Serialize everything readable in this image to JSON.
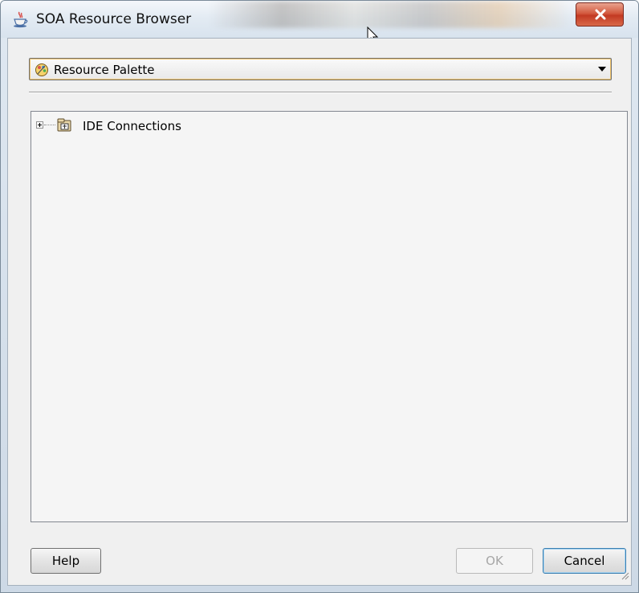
{
  "window": {
    "title": "SOA Resource Browser",
    "close_label": "x"
  },
  "selector": {
    "value": "Resource Palette",
    "icon": "resource-palette-icon"
  },
  "tree": {
    "items": [
      {
        "label": "IDE Connections",
        "icon": "connections-folder-icon",
        "expanded": false
      }
    ]
  },
  "buttons": {
    "help": "Help",
    "ok": "OK",
    "cancel": "Cancel"
  },
  "colors": {
    "close_button": "#c23a23",
    "focus_accent": "#3c7fb1",
    "combo_highlight": "#f2c56a"
  }
}
